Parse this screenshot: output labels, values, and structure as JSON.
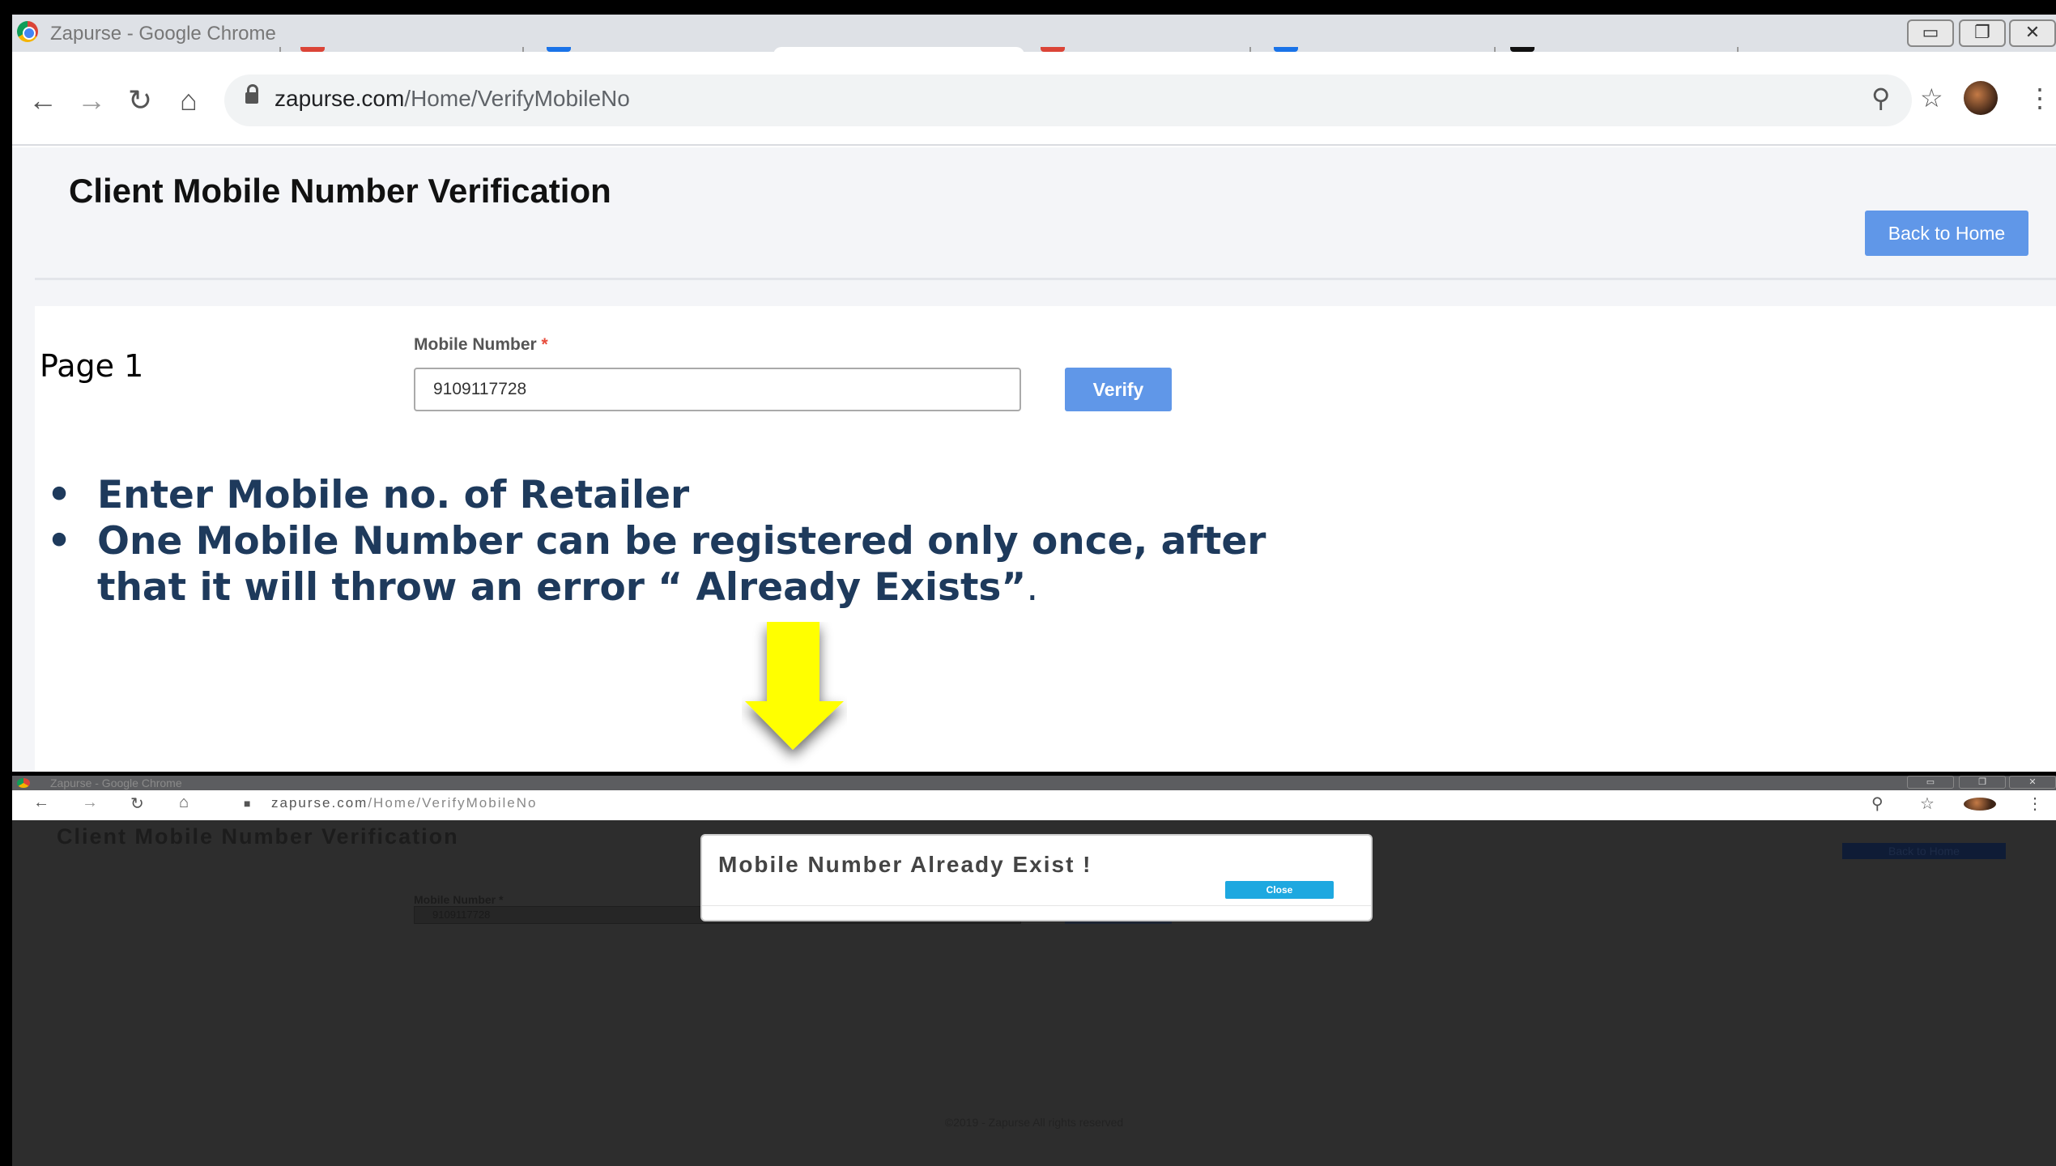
{
  "window": {
    "title": "Zapurse - Google Chrome",
    "min_icon": "minimize-icon",
    "restore_icon": "restore-icon",
    "close_icon": "close-icon"
  },
  "toolbar": {
    "url_domain": "zapurse.com",
    "url_path": "/Home/VerifyMobileNo"
  },
  "page": {
    "title": "Client Mobile Number Verification",
    "back_button": "Back to Home",
    "mobile_label": "Mobile Number",
    "required_mark": "*",
    "mobile_value": "9109117728",
    "verify_button": "Verify"
  },
  "annotation": {
    "page_label": "Page 1",
    "bullets": [
      "Enter Mobile no. of Retailer",
      "One Mobile Number can be registered only once, after that it will throw an error “ Already Exists”"
    ],
    "bullet2_tail": ".",
    "arrow_color": "#ffff00"
  },
  "modal_screen": {
    "window_title": "Zapurse - Google Chrome",
    "page_title": "Client Mobile Number Verification",
    "back_button": "Back to Home",
    "mobile_label": "Mobile Number *",
    "mobile_value": "9109117728",
    "modal_message": "Mobile Number Already Exist !",
    "close_button": "Close",
    "footer": "©2019 - Zapurse All rights reserved"
  },
  "colors": {
    "accent": "#6097e8",
    "close_button": "#1ea8e0",
    "annotation_text": "#1e3a5c"
  }
}
